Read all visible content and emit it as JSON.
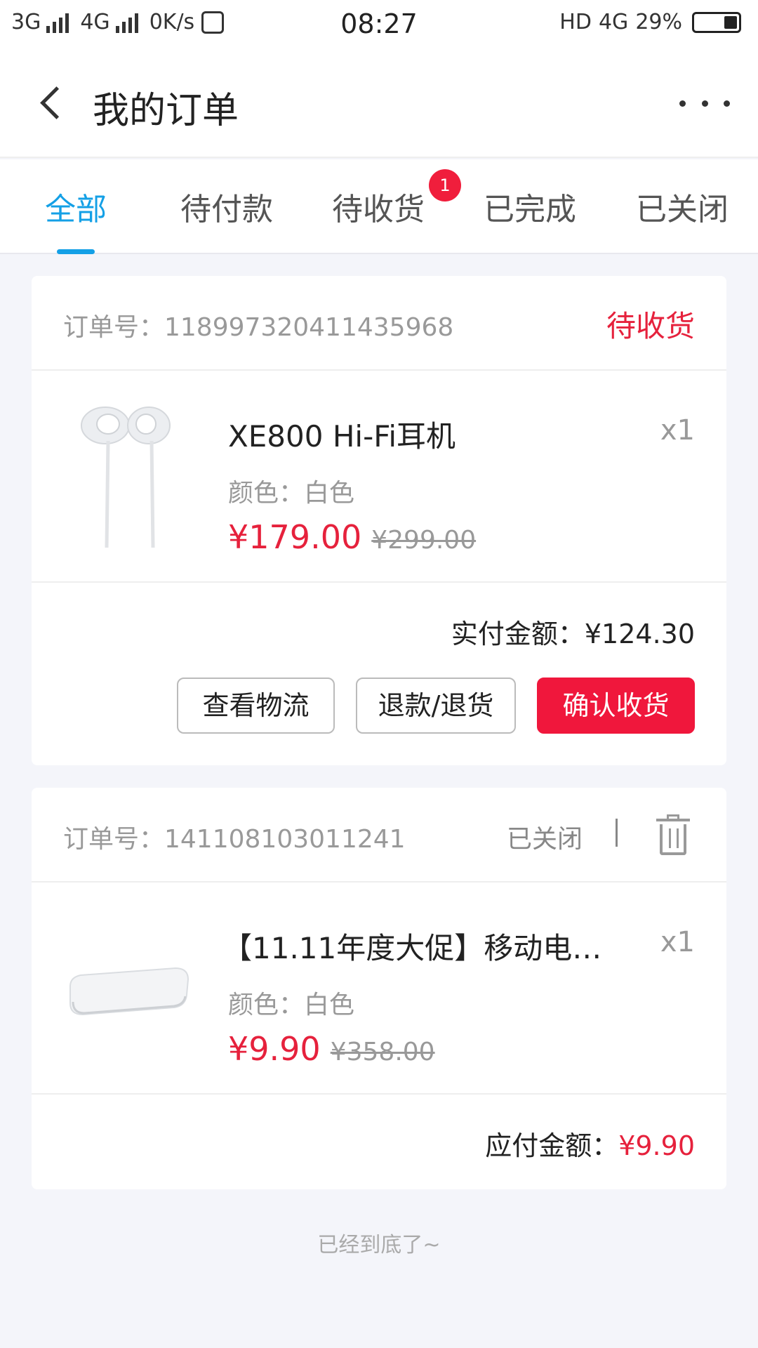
{
  "status_bar": {
    "net1": "3G",
    "net2": "4G",
    "speed": "0K/s",
    "time": "08:27",
    "hd": "HD",
    "net3": "4G",
    "battery": "29%"
  },
  "header": {
    "title": "我的订单",
    "back_icon": "chevron-left-icon",
    "more_icon": "more-dots-icon"
  },
  "tabs": [
    {
      "label": "全部",
      "active": true
    },
    {
      "label": "待付款"
    },
    {
      "label": "待收货",
      "badge": "1"
    },
    {
      "label": "已完成"
    },
    {
      "label": "已关闭"
    }
  ],
  "orders": [
    {
      "order_no": "订单号：118997320411435968",
      "status": "待收货",
      "product": {
        "name": "XE800 Hi-Fi耳机",
        "qty": "x1",
        "color": "颜色：白色",
        "price": "¥179.00",
        "original_price": "¥299.00"
      },
      "amount_label": "实付金额：",
      "amount": "¥124.30",
      "buttons": {
        "logistics": "查看物流",
        "refund": "退款/退货",
        "confirm": "确认收货"
      }
    },
    {
      "order_no": "订单号：141108103011241",
      "status": "已关闭",
      "product": {
        "name": "【11.11年度大促】移动电源…",
        "qty": "x1",
        "color": "颜色：白色",
        "price": "¥9.90",
        "original_price": "¥358.00"
      },
      "amount_label": "应付金额：",
      "amount": "¥9.90"
    }
  ],
  "footer_tip": "已经到底了~",
  "colors": {
    "accent": "#14a0e6",
    "red": "#e6213c",
    "bg": "#f4f5fa"
  }
}
